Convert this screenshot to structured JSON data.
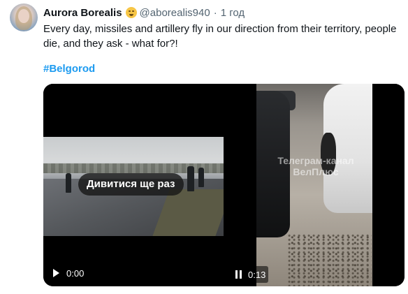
{
  "tweet": {
    "author_name": "Aurora Borealis",
    "emoji": "shushing-face-emoji",
    "handle": "@aborealis940",
    "separator": "·",
    "time": "1 год",
    "text": "Every day, missiles and artillery fly in our direction from their territory, people die, and they ask - what for?!",
    "hashtag": "#Belgorod"
  },
  "media": {
    "video1": {
      "rewatch_label": "Дивитися ще раз",
      "time": "0:00",
      "control_icon": "play-icon"
    },
    "video2": {
      "watermark": "Телеграм-канал ВелПлюс",
      "time": "0:13",
      "control_icon": "pause-icon"
    }
  },
  "colors": {
    "text": "#0f1419",
    "secondary": "#536471",
    "link": "#1d9bf0"
  }
}
